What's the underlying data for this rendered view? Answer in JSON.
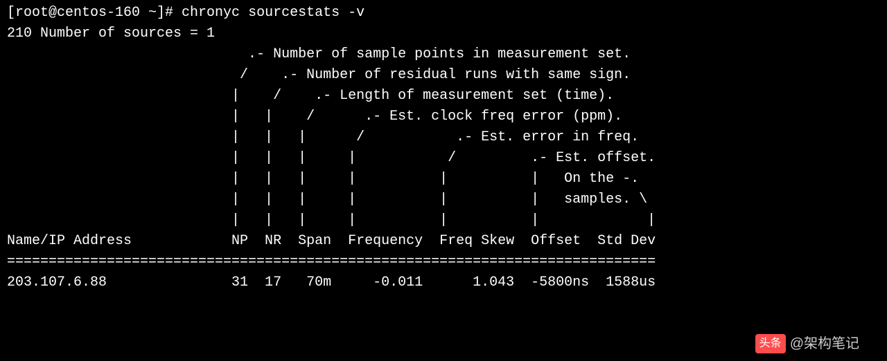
{
  "prompt": "[root@centos-160 ~]# ",
  "command": "chronyc sourcestats -v",
  "source_count_line": "210 Number of sources = 1",
  "diagram": {
    "l1": "                             .- Number of sample points in measurement set.",
    "l2": "                            /    .- Number of residual runs with same sign.",
    "l3": "                           |    /    .- Length of measurement set (time).",
    "l4": "                           |   |    /      .- Est. clock freq error (ppm).",
    "l5": "                           |   |   |      /           .- Est. error in freq.",
    "l6": "                           |   |   |     |           /         .- Est. offset.",
    "l7": "                           |   |   |     |          |          |   On the -.",
    "l8": "                           |   |   |     |          |          |   samples. \\",
    "l9": "                           |   |   |     |          |          |             |"
  },
  "header_line": "Name/IP Address            NP  NR  Span  Frequency  Freq Skew  Offset  Std Dev",
  "separator": "==============================================================================",
  "row": {
    "name_ip": "203.107.6.88",
    "np": "31",
    "nr": "17",
    "span": "70m",
    "frequency": "-0.011",
    "freq_skew": "1.043",
    "offset": "-5800ns",
    "std_dev": "1588us"
  },
  "row_line": "203.107.6.88               31  17   70m     -0.011      1.043  -5800ns  1588us",
  "watermark": {
    "badge": "头条",
    "text": "@架构笔记"
  }
}
